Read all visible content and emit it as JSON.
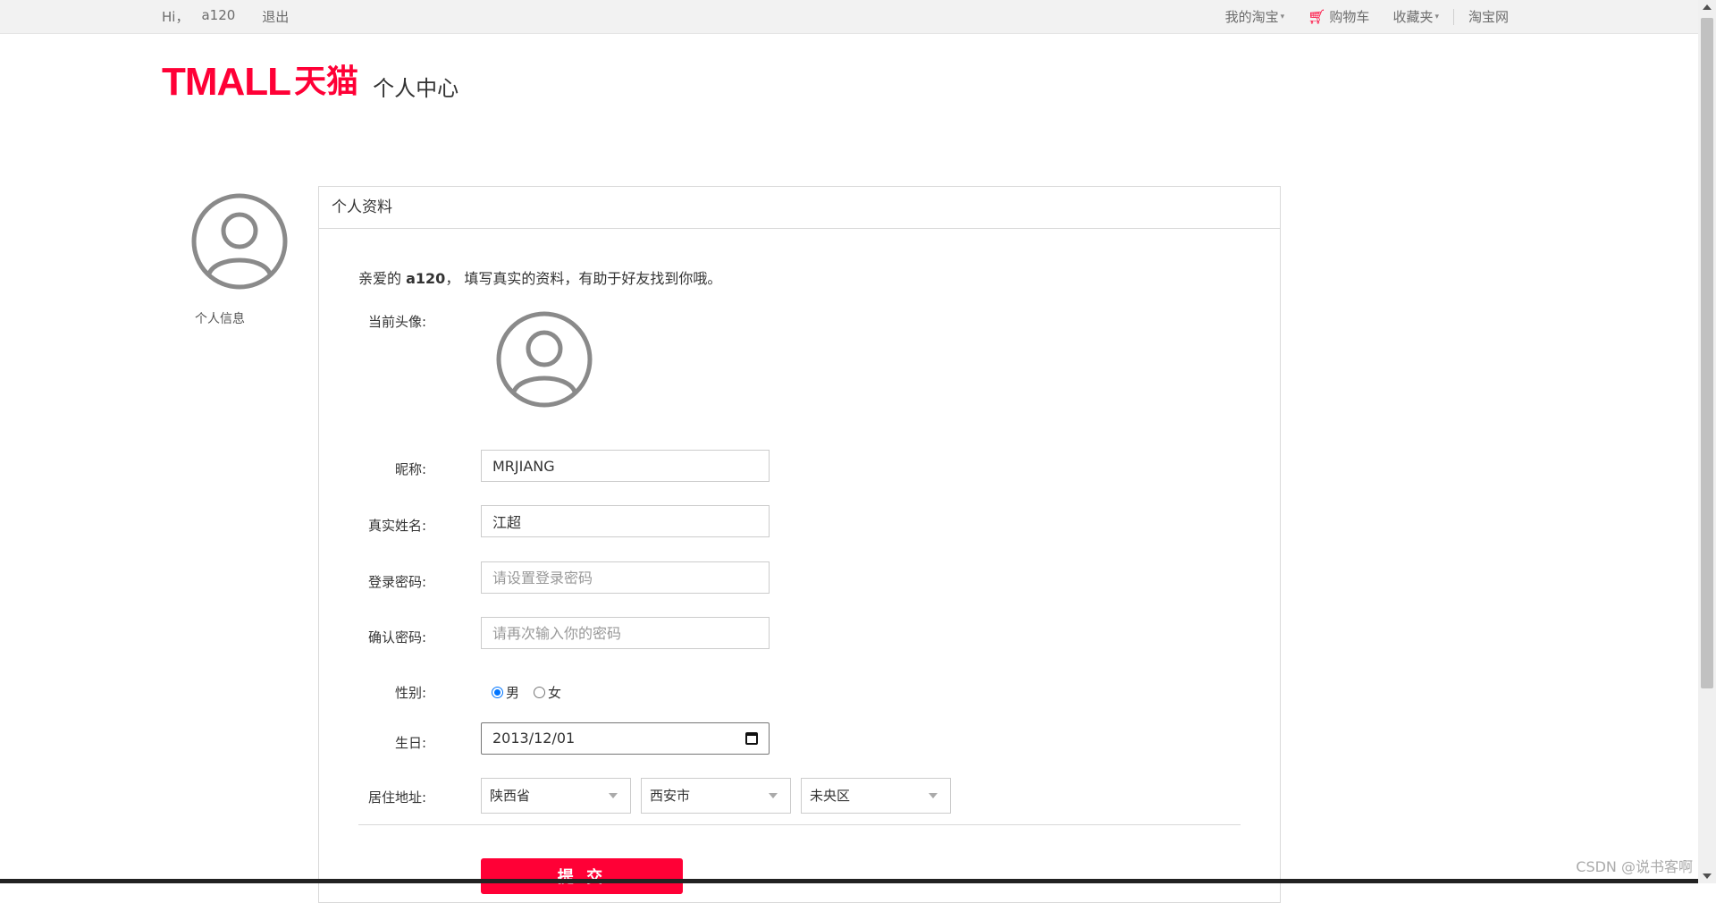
{
  "topbar": {
    "greeting": "Hi，",
    "username": "a120",
    "logout": "退出",
    "my_taobao": "我的淘宝",
    "cart": "购物车",
    "favorites": "收藏夹",
    "taobao": "淘宝网"
  },
  "header": {
    "logo_text": "TMALL",
    "logo_cn": "天猫",
    "section_title": "个人中心"
  },
  "sidebar": {
    "label": "个人信息"
  },
  "panel": {
    "title": "个人资料",
    "greeting_prefix": "亲爱的",
    "greeting_user": "a120",
    "greeting_suffix": "， 填写真实的资料，有助于好友找到你哦。"
  },
  "form": {
    "avatar_label": "当前头像:",
    "nickname_label": "昵称:",
    "nickname_value": "MRJIANG",
    "realname_label": "真实姓名:",
    "realname_value": "江超",
    "password_label": "登录密码:",
    "password_placeholder": "请设置登录密码",
    "confirm_label": "确认密码:",
    "confirm_placeholder": "请再次输入你的密码",
    "gender_label": "性别:",
    "gender_male": "男",
    "gender_female": "女",
    "gender_selected": "男",
    "birthday_label": "生日:",
    "birthday_value": "2013/12/01",
    "address_label": "居住地址:",
    "province": "陕西省",
    "city": "西安市",
    "district": "未央区",
    "submit_label": "提 交"
  },
  "watermark": "CSDN @说书客啊",
  "colors": {
    "brand": "#ff0036",
    "radio": "#0075ff"
  }
}
